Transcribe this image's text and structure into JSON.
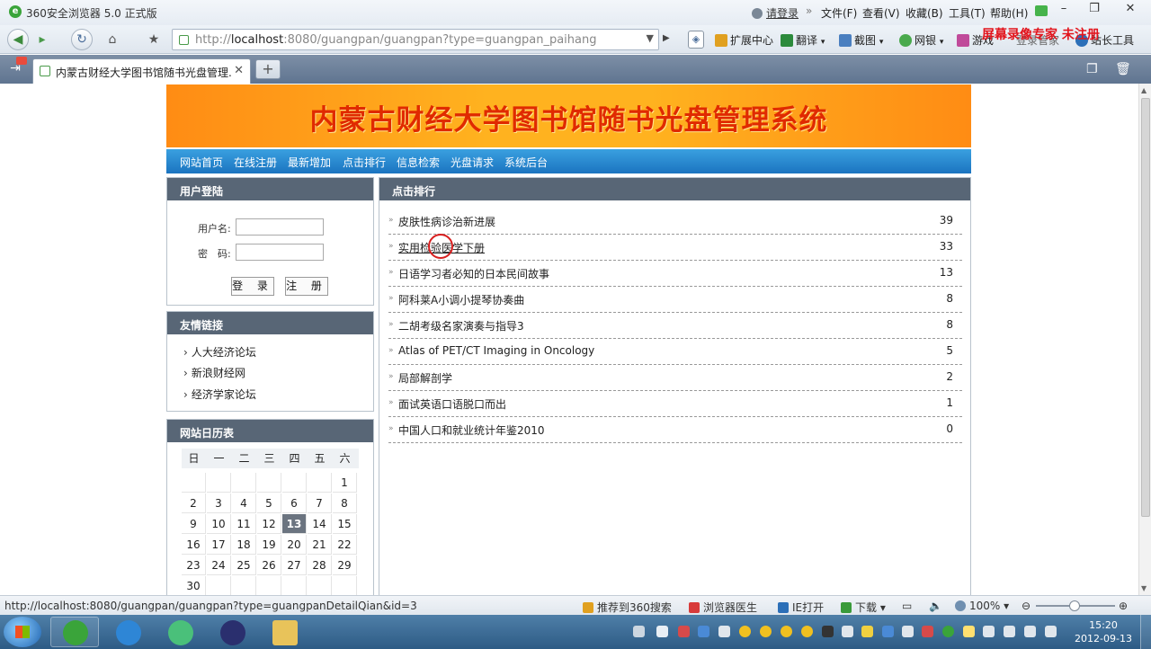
{
  "browser": {
    "title": "360安全浏览器 5.0 正式版",
    "login_link": "请登录",
    "menu": [
      "文件(F)",
      "查看(V)",
      "收藏(B)",
      "工具(T)",
      "帮助(H)"
    ],
    "address_prefix": "http://",
    "address_host": "localhost",
    "address_rest": ":8080/guangpan/guangpan?type=guangpan_paihang",
    "toolbar": {
      "extensions": "扩展中心",
      "translate": "翻译",
      "screenshot": "截图",
      "netbank": "网银",
      "games": "游戏",
      "login_helper": "登录管家",
      "admin_tools": "站长工具"
    },
    "watermark": "屏幕录像专家 未注册",
    "tab_title": "内蒙古财经大学图书馆随书光盘管理...",
    "status_url": "http://localhost:8080/guangpan/guangpan?type=guangpanDetailQian&id=3",
    "status_items": {
      "recommend": "推荐到360搜索",
      "doctor": "浏览器医生",
      "ie_open": "IE打开",
      "download": "下载",
      "zoom": "100%"
    }
  },
  "site": {
    "banner_title": "内蒙古财经大学图书馆随书光盘管理系统",
    "nav": [
      "网站首页",
      "在线注册",
      "最新增加",
      "点击排行",
      "信息检索",
      "光盘请求",
      "系统后台"
    ],
    "login_box": {
      "title": "用户登陆",
      "username_label": "用户名:",
      "password_label": "密　码:",
      "login_button": "登 录",
      "register_button": "注 册"
    },
    "links_box": {
      "title": "友情链接",
      "links": [
        "人大经济论坛",
        "新浪财经网",
        "经济学家论坛"
      ]
    },
    "calendar": {
      "title": "网站日历表",
      "weekdays": [
        "日",
        "一",
        "二",
        "三",
        "四",
        "五",
        "六"
      ],
      "days": [
        "",
        "",
        "",
        "",
        "",
        "",
        "1",
        "2",
        "3",
        "4",
        "5",
        "6",
        "7",
        "8",
        "9",
        "10",
        "11",
        "12",
        "13",
        "14",
        "15",
        "16",
        "17",
        "18",
        "19",
        "20",
        "21",
        "22",
        "23",
        "24",
        "25",
        "26",
        "27",
        "28",
        "29",
        "30",
        "",
        "",
        "",
        "",
        "",
        ""
      ],
      "today": "13"
    },
    "ranking": {
      "title": "点击排行",
      "items": [
        {
          "title": "皮肤性病诊治新进展",
          "count": "39"
        },
        {
          "title": "实用检验医学下册",
          "count": "33"
        },
        {
          "title": "日语学习者必知的日本民间故事",
          "count": "13"
        },
        {
          "title": "阿科莱A小调小提琴协奏曲",
          "count": "8"
        },
        {
          "title": "二胡考级名家演奏与指导3",
          "count": "8"
        },
        {
          "title": "Atlas of PET/CT Imaging in Oncology",
          "count": "5"
        },
        {
          "title": "局部解剖学",
          "count": "2"
        },
        {
          "title": "面试英语口语脱口而出",
          "count": "1"
        },
        {
          "title": "中国人口和就业统计年鉴2010",
          "count": "0"
        }
      ]
    }
  },
  "taskbar": {
    "time": "15:20",
    "date": "2012-09-13"
  },
  "colors": {
    "banner_orange": "#ffb21f",
    "nav_blue": "#1b74c0",
    "box_header": "#586676",
    "watermark_red": "#e2141c"
  }
}
